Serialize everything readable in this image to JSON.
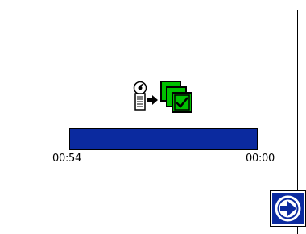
{
  "screen": {
    "status_icons": [
      "pump-meter-icon",
      "arrow-right-icon",
      "recipe-stack-check-icon"
    ],
    "accent_green": "#00c000",
    "bar_color": "#0b2a9f"
  },
  "progress": {
    "fraction_remaining": 1.0,
    "start_label": "00:54",
    "end_label": "00:00"
  },
  "navigation": {
    "next_icon": "arrow-right-circle-icon"
  }
}
